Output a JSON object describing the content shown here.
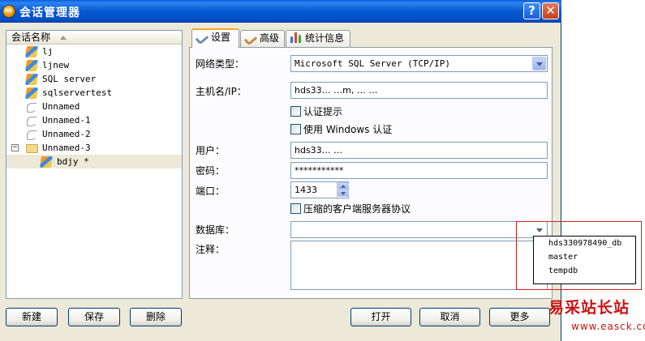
{
  "window": {
    "title": "会话管理器",
    "app_icon_text": "HS",
    "help_label": "?",
    "close_label": "✕"
  },
  "session_list": {
    "header": "会话名称",
    "items": [
      {
        "label": "lj",
        "icon": "sql-server-icon"
      },
      {
        "label": "ljnew",
        "icon": "sql-server-icon"
      },
      {
        "label": "SQL server",
        "icon": "sql-server-icon"
      },
      {
        "label": "sqlservertest",
        "icon": "sql-server-icon"
      },
      {
        "label": "Unnamed",
        "icon": "dolphin-icon"
      },
      {
        "label": "Unnamed-1",
        "icon": "dolphin-icon"
      },
      {
        "label": "Unnamed-2",
        "icon": "dolphin-icon"
      },
      {
        "label": "Unnamed-3",
        "icon": "folder-icon",
        "expander": "−"
      },
      {
        "label": "bdjy *",
        "icon": "sql-server-icon"
      }
    ]
  },
  "tabs": [
    "设置",
    "高级",
    "统计信息"
  ],
  "settings": {
    "network_type_label": "网络类型：",
    "network_type_value": "Microsoft SQL Server (TCP/IP)",
    "host_label": "主机名/IP：",
    "host_value": "hds33…      …m, …   …",
    "prompt_auth_label": "认证提示",
    "windows_auth_label": "使用 Windows 认证",
    "user_label": "用户：",
    "user_value": "hds33…    …",
    "password_label": "密码：",
    "password_value": "***********",
    "port_label": "端口：",
    "port_value": "1433",
    "compress_label": "压缩的客户端服务器协议",
    "database_label": "数据库：",
    "database_value": "",
    "comment_label": "注释："
  },
  "database_options": [
    "hds330978490_db",
    "master",
    "tempdb"
  ],
  "buttons": {
    "new": "新建",
    "save": "保存",
    "delete": "删除",
    "open": "打开",
    "cancel": "取消",
    "more": "更多"
  },
  "watermark": {
    "main": "易采站长站",
    "sub": "www.easck.com"
  }
}
